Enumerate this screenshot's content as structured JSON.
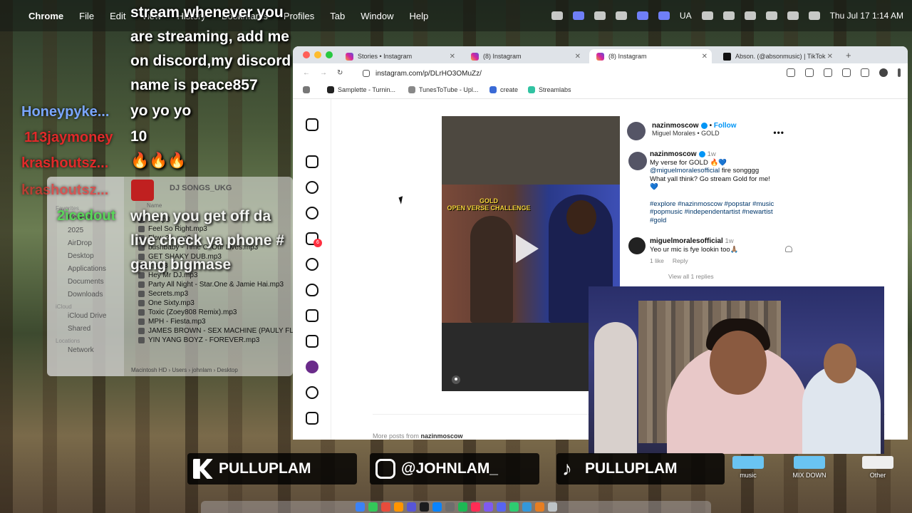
{
  "menubar": {
    "apple": "",
    "items": [
      "Chrome",
      "File",
      "Edit",
      "View",
      "History",
      "Bookmarks",
      "Profiles",
      "Tab",
      "Window",
      "Help"
    ],
    "status_lang": "UA",
    "datetime": "Thu Jul 17  1:14 AM"
  },
  "chat": {
    "users": [
      {
        "name": "Honeypyke...",
        "color": "#7aa6ff"
      },
      {
        "name": "113jaymoney",
        "color": "#e02a2a"
      },
      {
        "name": "krashoutsz...",
        "color": "#e02a2a"
      },
      {
        "name": "krashoutsz...",
        "color": "#e02a2a"
      },
      {
        "name": "2icedout",
        "color": "#5ad65a"
      }
    ],
    "messages": [
      "stream whenever you",
      "are streaming, add me",
      "on discord,my discord",
      "name is peace857",
      "yo yo yo",
      "10",
      "🔥🔥🔥",
      "when you get off da",
      "live check ya phone #",
      "gang bigmase"
    ]
  },
  "finder": {
    "title": "DJ SONGS_UKG",
    "column_name": "Name",
    "sidebar": {
      "favorites_header": "Favorites",
      "favorites": [
        "Recents",
        "2025",
        "AirDrop",
        "Desktop",
        "Applications",
        "Documents",
        "Downloads"
      ],
      "icloud_header": "iCloud",
      "icloud": [
        "iCloud Drive",
        "Shared"
      ],
      "locations_header": "Locations",
      "locations": [
        "Network"
      ]
    },
    "files": [
      "....mp3",
      "Feel So Right.mp3",
      "Flow 2 ...mp3",
      "bushbaby - Time O' Our Lives.mp3",
      "GET SHAKY DUB.mp3",
      "...mp3",
      "Hey Mr DJ.mp3",
      "Party All Night - Star.One & Jamie Hai.mp3",
      "Secrets.mp3",
      "One Sixty.mp3",
      "Toxic (Zoey808 Remix).mp3",
      "MPH - Fiesta.mp3",
      "JAMES BROWN - SEX MACHINE (PAULY FLIP",
      "YIN YANG BOYZ - FOREVER.mp3"
    ],
    "path": [
      "Macintosh HD",
      "Users",
      "johnlam",
      "Desktop"
    ]
  },
  "browser": {
    "tabs": [
      {
        "label": "Stories • Instagram",
        "kind": "ig"
      },
      {
        "label": "(8) Instagram",
        "kind": "ig"
      },
      {
        "label": "(8) Instagram",
        "kind": "ig"
      },
      {
        "label": "Abson. (@absonmusic) | TikTok",
        "kind": "tiktok"
      }
    ],
    "url": "instagram.com/p/DLrHO3OMuZz/",
    "bookmarks": [
      {
        "label": "Samplette - Turnin...",
        "color": "#222"
      },
      {
        "label": "TunesToTube - Upl...",
        "color": "#888"
      },
      {
        "label": "create",
        "color": "#3a6ad6"
      },
      {
        "label": "Streamlabs",
        "color": "#31c3a2"
      }
    ]
  },
  "instagram": {
    "notif_count": "6",
    "post": {
      "username": "nazinmoscow",
      "follow": "Follow",
      "audio": "Miguel Morales • GOLD",
      "more": "•••",
      "video_label_1": "GOLD",
      "video_label_2": "OPEN VERSE CHALLENGE",
      "caption_user": "nazinmoscow",
      "caption_time": "1w",
      "caption_line1": "My verse for GOLD 🔥💙",
      "caption_mention": "@miguelmoralesofficial",
      "caption_line2": " fire songggg",
      "caption_line3": "What yall think? Go stream Gold for me!",
      "caption_line4": "💙",
      "hashtags": "#explore #nazinmoscow #popstar #music #popmusic #independentartist #newartist #gold",
      "comment_user": "miguelmoralesofficial",
      "comment_time": "1w",
      "comment_text": "Yeo ur mic is fye lookin too🙏🏽",
      "comment_likes": "1 like",
      "comment_reply": "Reply",
      "view_replies": "View all 1 replies",
      "more_posts_prefix": "More posts from",
      "more_posts_user": "nazinmoscow"
    }
  },
  "banner": {
    "items": [
      "PULLUPLAM",
      "@JOHNLAM_",
      "PULLUPLAM"
    ]
  },
  "desktop_folders": [
    "music",
    "MIX DOWN",
    "Other"
  ]
}
